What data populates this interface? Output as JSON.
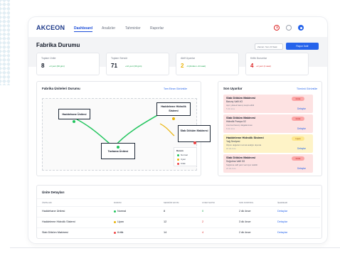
{
  "nav": {
    "brand": "AKCEON",
    "links": [
      "Dashboard",
      "Analizler",
      "Tahminler",
      "Raporlar"
    ]
  },
  "header": {
    "title": "Fabrika Durumu",
    "last_update": "Zaman: Son 24 Saat",
    "report_button": "Rapor İndir"
  },
  "stats": [
    {
      "label": "Toplam Ünite",
      "value": "8",
      "change": "+0 yeni (30 gün)",
      "change_color": "#16a34a"
    },
    {
      "label": "Toplam Sensör",
      "value": "71",
      "change": "+12 yeni (30 gün)",
      "change_color": "#16a34a"
    },
    {
      "label": "Aktif Uyarılar",
      "value": "2",
      "change": "-3 (dünden -24 saat)",
      "change_color": "#16a34a",
      "value_color": "#eab308"
    },
    {
      "label": "Kritik Durumlar",
      "value": "4",
      "change": "+2 yeni (1 saat)",
      "change_color": "#dc2626",
      "value_color": "#dc2626"
    }
  ],
  "units_panel": {
    "title": "Fabrika Üniteleri Durumu",
    "link": "Tam Ekran Görüntüle",
    "nodes": [
      "Haddehane Ünitesi",
      "Haddeleme Hidrolik Sistemi",
      "Tavlama Ünitesi",
      "Slab Döküm Makinesi"
    ],
    "legend_title": "Durum",
    "legend": [
      {
        "label": "Normal",
        "color": "#22c55e"
      },
      {
        "label": "Uyarı",
        "color": "#eab308"
      },
      {
        "label": "Kritik",
        "color": "#ef4444"
      }
    ]
  },
  "alerts_panel": {
    "title": "Son Uyarılar",
    "link": "Tümünü Görüntüle",
    "items": [
      {
        "title": "Slab Döküm Makinesi",
        "system": "Basınç Valfi 4G",
        "desc": "Aşırı yüksek basınç tespit edildi",
        "time": "5 dk önce",
        "badge": "Kritik",
        "level": "critical",
        "details": "Detaylar"
      },
      {
        "title": "Slab Döküm Makinesi",
        "system": "Hidrolik Pompa 02",
        "desc": "Anormal basınç dalgalanması",
        "time": "8 dk önce",
        "badge": "Kritik",
        "level": "critical",
        "details": "Detaylar"
      },
      {
        "title": "Haddeleme Hidrolik Sistemi",
        "system": "Yağ Seviyesi",
        "desc": "Ölçüm değerleri normal aralığın dışında",
        "time": "18 dk önce",
        "badge": "Uyarı",
        "level": "warning",
        "details": "Detaylar"
      },
      {
        "title": "Slab Döküm Makinesi",
        "system": "Soğutma Valfi 3G",
        "desc": "Soğutma valfi yanıt vermiyor olabilir",
        "time": "24 dk önce",
        "badge": "Kritik",
        "level": "critical",
        "details": "Detaylar"
      }
    ]
  },
  "table": {
    "title": "Ünite Detayları",
    "headers": [
      "Ünite Adı",
      "Durum",
      "Sensör Sayısı",
      "Uyarı Sayısı",
      "Son Kontrol",
      "İşlemler"
    ],
    "rows": [
      {
        "name": "Haddehane Ünitesi",
        "status": "Normal",
        "status_color": "#22c55e",
        "sensors": "8",
        "alerts": "0",
        "alerts_color": "#16a34a",
        "last_check": "2 dk önce",
        "action": "Detaylar"
      },
      {
        "name": "Haddeleme Hidrolik Sistemi",
        "status": "Uyarı",
        "status_color": "#eab308",
        "sensors": "12",
        "alerts": "2",
        "alerts_color": "#dc2626",
        "last_check": "3 dk önce",
        "action": "Detaylar"
      },
      {
        "name": "Slab Döküm Makinesi",
        "status": "Kritik",
        "status_color": "#ef4444",
        "sensors": "14",
        "alerts": "4",
        "alerts_color": "#dc2626",
        "last_check": "2 dk önce",
        "action": "Detaylar"
      }
    ]
  }
}
